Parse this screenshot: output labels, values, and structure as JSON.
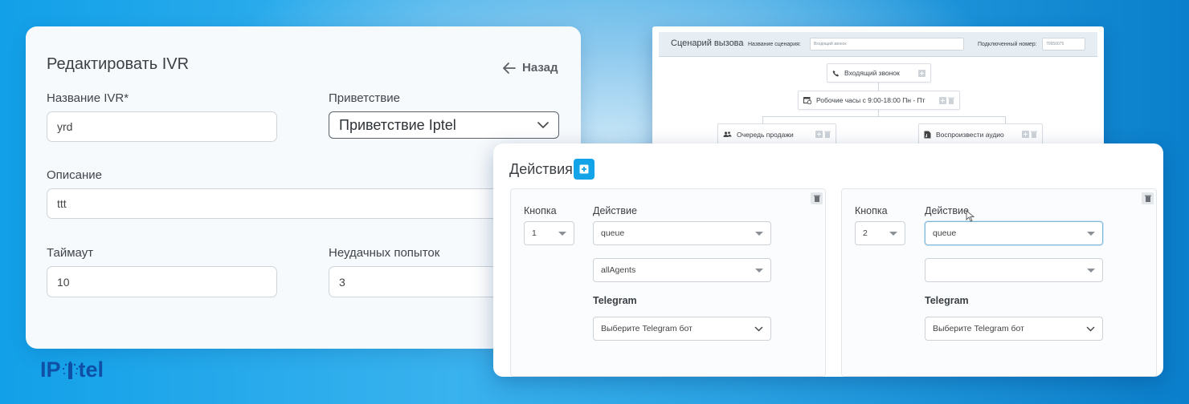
{
  "colors": {
    "accent": "#12a3e8",
    "logo": "#0f4fa5"
  },
  "ivr_edit": {
    "title": "Редактировать IVR",
    "back_label": "Назад",
    "name_label": "Название IVR*",
    "name_value": "yrd",
    "greeting_label": "Приветствие",
    "greeting_value": "Приветствие Iptel",
    "description_label": "Описание",
    "description_value": "ttt",
    "timeout_label": "Таймаут",
    "timeout_value": "10",
    "attempts_label": "Неудачных попыток",
    "attempts_value": "3"
  },
  "scenario": {
    "title": "Сценарий вызова",
    "name_label": "Название сценария:",
    "name_value": "Входящий звонок",
    "number_label": "Подключенный номер:",
    "number_value": "70950075",
    "nodes": {
      "incoming": "Входящий звонок",
      "hours": "Робочие часы с 9:00-18:00 Пн - Пт",
      "queue": "Очередь продажи",
      "audio": "Воспроизвести аудио"
    }
  },
  "actions": {
    "title": "Действия",
    "columns": [
      {
        "button_label": "Кнопка",
        "button_value": "1",
        "action_label": "Действие",
        "action_value": "queue",
        "sub_value": "allAgents",
        "telegram_label": "Telegram",
        "telegram_value": "Выберите Telegram бот"
      },
      {
        "button_label": "Кнопка",
        "button_value": "2",
        "action_label": "Действие",
        "action_value": "queue",
        "sub_value": "",
        "telegram_label": "Telegram",
        "telegram_value": "Выберите Telegram бот"
      }
    ]
  },
  "logo": {
    "text": "tel",
    "prefix": "IP"
  }
}
